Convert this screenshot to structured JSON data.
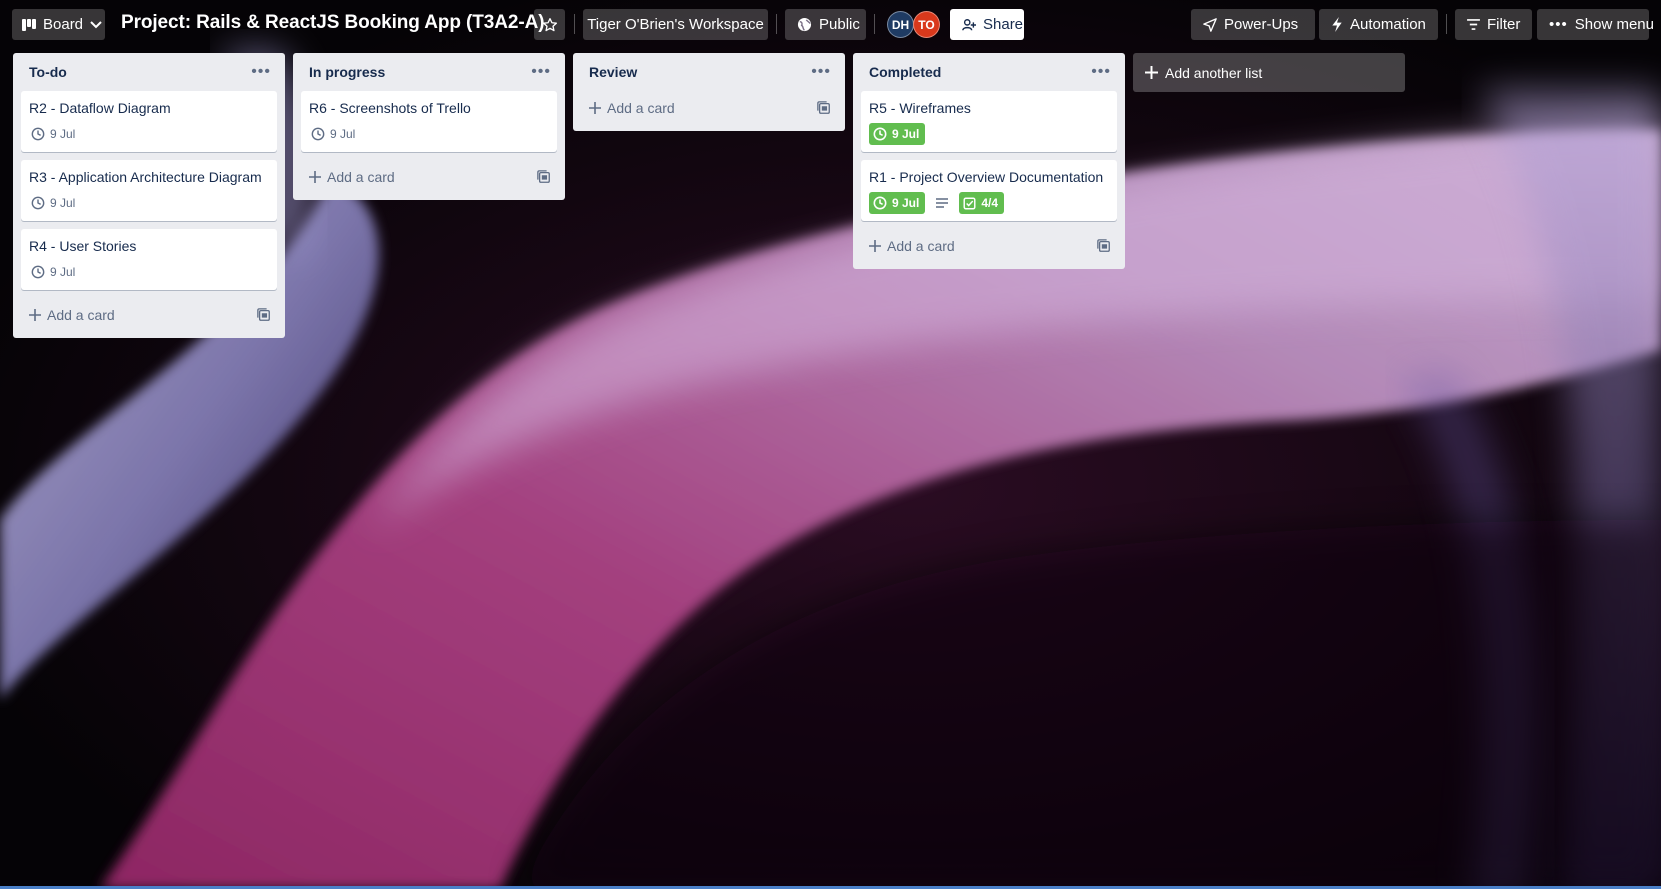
{
  "header": {
    "view_label": "Board",
    "board_title": "Project: Rails & ReactJS Booking App (T3A2-A)",
    "workspace": "Tiger O'Brien's Workspace",
    "visibility": "Public",
    "members": [
      {
        "initials": "DH",
        "color": "#1f3b63"
      },
      {
        "initials": "TO",
        "color": "#d9391c"
      }
    ],
    "share_label": "Share",
    "powerups_label": "Power-Ups",
    "automation_label": "Automation",
    "filter_label": "Filter",
    "show_menu_label": "Show menu"
  },
  "lists": [
    {
      "title": "To-do",
      "cards": [
        {
          "title": "R2 - Dataflow Diagram",
          "due": "9 Jul"
        },
        {
          "title": "R3 - Application Architecture Diagram",
          "due": "9 Jul"
        },
        {
          "title": "R4 - User Stories",
          "due": "9 Jul"
        }
      ],
      "add_card_label": "Add a card"
    },
    {
      "title": "In progress",
      "cards": [
        {
          "title": "R6 - Screenshots of Trello",
          "due": "9 Jul"
        }
      ],
      "add_card_label": "Add a card"
    },
    {
      "title": "Review",
      "cards": [],
      "add_card_label": "Add a card"
    },
    {
      "title": "Completed",
      "cards": [
        {
          "title": "R5 - Wireframes",
          "due": "9 Jul"
        },
        {
          "title": "R1 - Project Overview Documentation",
          "due": "9 Jul",
          "checklist": "4/4"
        }
      ],
      "add_card_label": "Add a card"
    }
  ],
  "add_list_label": "Add another list",
  "colors": {
    "list_bg": "#ebecf0",
    "due_complete": "#61bd4f",
    "text": "#172b4d",
    "muted": "#5e6c84"
  }
}
